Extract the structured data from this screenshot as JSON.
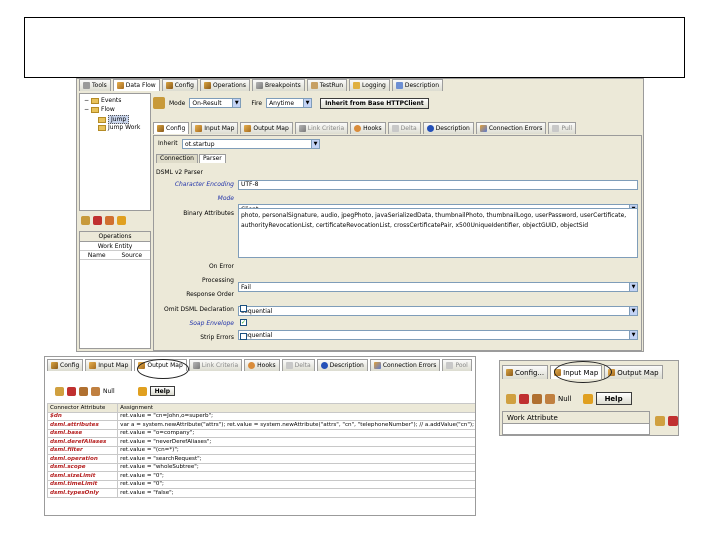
{
  "main": {
    "tabs": [
      "Tools",
      "Data Flow",
      "Config",
      "Operations",
      "Breakpoints",
      "TestRun",
      "Logging",
      "Description"
    ],
    "tree": [
      "Events",
      "Flow",
      "Jump",
      "Jump Work"
    ],
    "mode_label": "Mode",
    "mode_value": "On-Result",
    "fire_label": "Fire",
    "fire_value": "Anytime",
    "inherit_button": "Inherit from Base HTTPClient",
    "ops_title": "Operations",
    "ops_sub": "Work Entity",
    "ops_cols": [
      "Name",
      "Source"
    ],
    "subtabs": [
      "Config",
      "Input Map",
      "Output Map",
      "Link Criteria",
      "Hooks",
      "Delta",
      "Description",
      "Connection Errors",
      "Pull"
    ],
    "inherit_label": "Inherit",
    "inherit_value": "ot.startup",
    "mini_tabs": [
      "Connection",
      "Parser"
    ],
    "parser_title": "DSML v2 Parser",
    "fields": {
      "char_encoding_label": "Character Encoding",
      "char_encoding_value": "UTF-8",
      "mode_label": "Mode",
      "mode_value": "Client",
      "binary_attrs_label": "Binary Attributes",
      "binary_attrs_text": "photo, personalSignature, audio, jpegPhoto, javaSerializedData, thumbnailPhoto, thumbnailLogo, userPassword, userCertificate, authorityRevocationList, certificateRevocationList, crossCertificatePair, x500UniqueIdentifier, objectGUID, objectSid",
      "on_error_label": "On Error",
      "on_error_value": "Fail",
      "processing_label": "Processing",
      "processing_value": "sequential",
      "response_order_label": "Response Order",
      "response_order_value": "sequential",
      "omit_dsml_label": "Omit DSML Declaration",
      "soap_env_label": "Soap Envelope",
      "strip_errors_label": "Strip Errors"
    }
  },
  "bottom_left": {
    "tabs": [
      "Config",
      "Input Map",
      "Output Map",
      "Link Criteria",
      "Hooks",
      "Delta",
      "Description",
      "Connection Errors",
      "Pool"
    ],
    "null_label": "Null",
    "help_label": "Help",
    "col_attr": "Connector Attribute",
    "col_assign": "Assignment",
    "rows": [
      {
        "attr": "$dn",
        "value": "ret.value = \"cn=John,o=superb\";"
      },
      {
        "attr": "dsml.attributes",
        "value": "var a = system.newAttribute(\"attrs\"); ret.value = system.newAttribute(\"attrs\", \"cn\", \"telephoneNumber\"); // a.addValue(\"cn\");"
      },
      {
        "attr": "dsml.base",
        "value": "ret.value = \"o=company\";"
      },
      {
        "attr": "dsml.derefAliases",
        "value": "ret.value = \"neverDerefAliases\";"
      },
      {
        "attr": "dsml.filter",
        "value": "ret.value = \"(cn=*)\";"
      },
      {
        "attr": "dsml.operation",
        "value": "ret.value = \"searchRequest\";"
      },
      {
        "attr": "dsml.scope",
        "value": "ret.value = \"wholeSubtree\";"
      },
      {
        "attr": "dsml.sizeLimit",
        "value": "ret.value = \"0\";"
      },
      {
        "attr": "dsml.timeLimit",
        "value": "ret.value = \"0\";"
      },
      {
        "attr": "dsml.typesOnly",
        "value": "ret.value = \"false\";"
      }
    ]
  },
  "bottom_right": {
    "tabs": [
      "Config...",
      "Input Map",
      "Output Map"
    ],
    "null_label": "Null",
    "help_label": "Help",
    "grid_head": "Work Attribute"
  },
  "colors": {
    "accent_red": "#b52020",
    "panel_bg": "#ece9d8"
  }
}
